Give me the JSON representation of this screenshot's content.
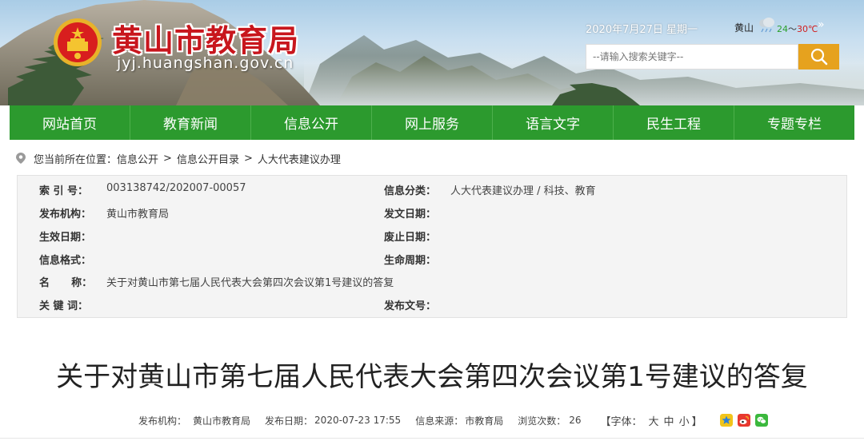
{
  "header": {
    "site_title": "黄山市教育局",
    "site_domain": "jyj.huangshan.gov.cn",
    "date": "2020年7月27日 星期一",
    "weather": {
      "city": "黄山",
      "temp_low": "24",
      "temp_sep": "～",
      "temp_high": "30℃",
      "more": "»"
    },
    "search": {
      "placeholder": "--请输入搜索关键字--"
    }
  },
  "nav": {
    "items": [
      {
        "label": "网站首页"
      },
      {
        "label": "教育新闻"
      },
      {
        "label": "信息公开"
      },
      {
        "label": "网上服务"
      },
      {
        "label": "语言文字"
      },
      {
        "label": "民生工程"
      },
      {
        "label": "专题专栏"
      }
    ]
  },
  "breadcrumb": {
    "prefix": "您当前所在位置：",
    "items": [
      "信息公开",
      "信息公开目录",
      "人大代表建议办理"
    ],
    "separator": ">"
  },
  "info": {
    "index_label": "索 引 号：",
    "index_value": "003138742/202007-00057",
    "category_label": "信息分类：",
    "category_value": "人大代表建议办理 / 科技、教育",
    "publisher_label": "发布机构：",
    "publisher_value": "黄山市教育局",
    "publish_date_label": "发文日期：",
    "publish_date_value": "",
    "effective_date_label": "生效日期：",
    "effective_date_value": "",
    "repeal_date_label": "废止日期：",
    "repeal_date_value": "",
    "format_label": "信息格式：",
    "format_value": "",
    "lifecycle_label": "生命周期：",
    "lifecycle_value": "",
    "name_label": "名      称：",
    "name_value": "关于对黄山市第七届人民代表大会第四次会议第1号建议的答复",
    "keywords_label": "关 键 词：",
    "keywords_value": "",
    "doc_number_label": "发布文号：",
    "doc_number_value": ""
  },
  "article": {
    "title": "关于对黄山市第七届人民代表大会第四次会议第1号建议的答复",
    "meta": {
      "publisher_label": "发布机构：",
      "publisher_value": "黄山市教育局",
      "date_label": "发布日期：",
      "date_value": "2020-07-23 17:55",
      "source_label": "信息来源：",
      "source_value": "市教育局",
      "views_label": "浏览次数：",
      "views_value": "26",
      "font_label": "【字体：",
      "font_large": "大",
      "font_medium": "中",
      "font_small": "小",
      "font_close": "】"
    }
  },
  "colors": {
    "nav_green": "#2c9a2e",
    "title_red": "#c8161d",
    "search_button": "#e6a21e",
    "info_bg": "#f4f4f4"
  },
  "icons": {
    "emblem": "national-emblem-icon",
    "weather": "cloudy-rain-icon",
    "search": "search-icon",
    "location": "location-pin-icon",
    "share": [
      "qzone-icon",
      "weibo-icon",
      "wechat-icon"
    ]
  }
}
